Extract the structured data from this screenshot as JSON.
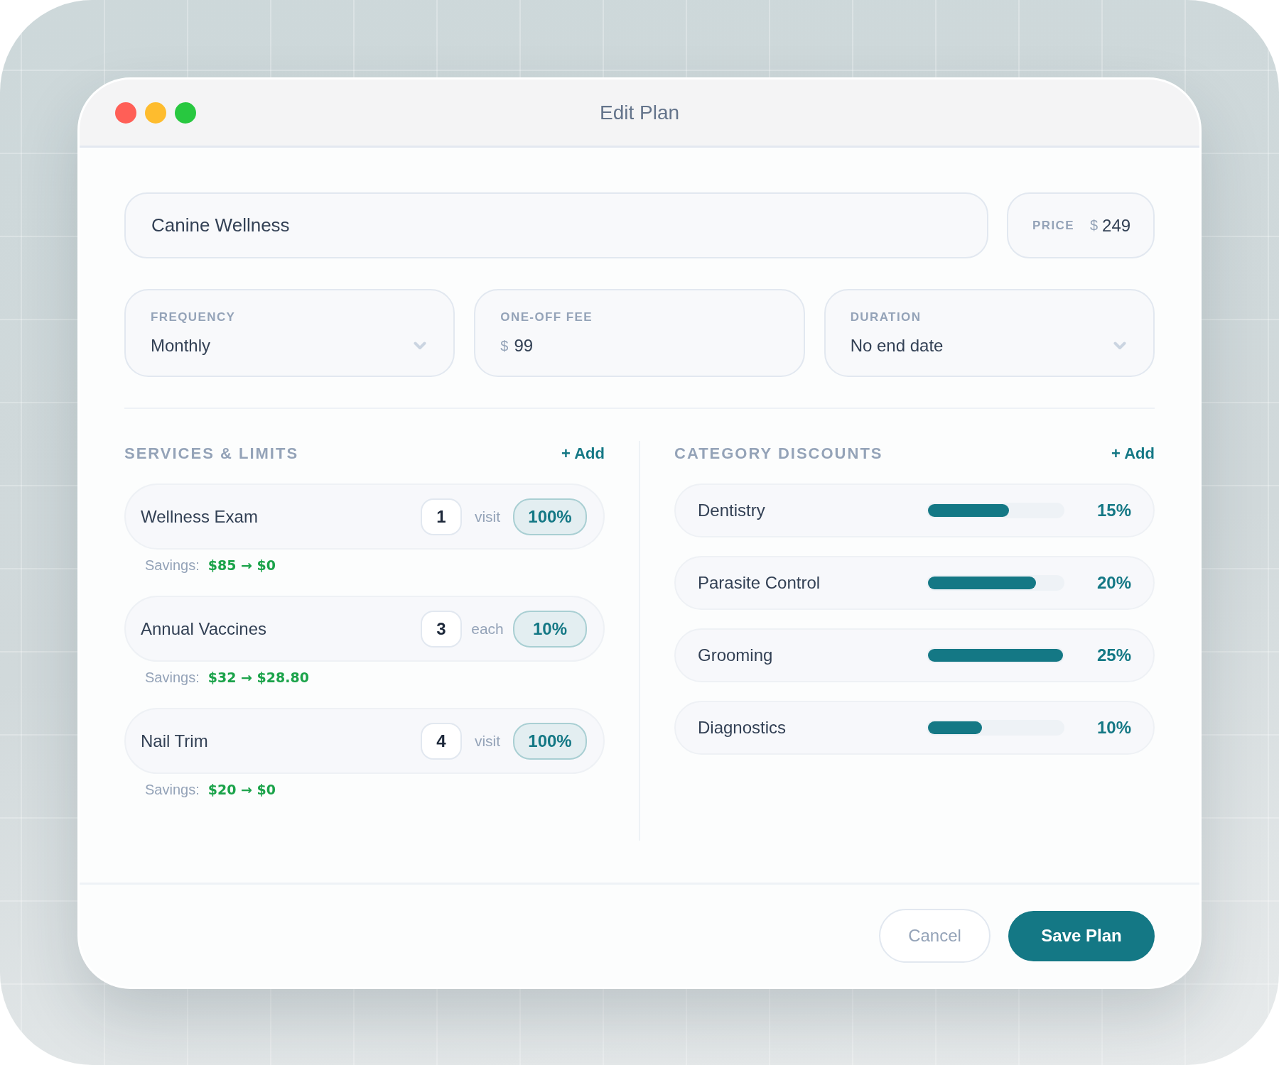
{
  "window": {
    "title": "Edit Plan"
  },
  "plan_name": {
    "value": "Canine Wellness"
  },
  "price": {
    "label": "PRICE",
    "currency": "$",
    "value": "249"
  },
  "fields": [
    {
      "kind": "select",
      "label": "FREQUENCY",
      "value": "Monthly"
    },
    {
      "kind": "money",
      "label": "ONE-OFF FEE",
      "currency": "$",
      "value": "99"
    },
    {
      "kind": "select",
      "label": "DURATION",
      "value": "No end date"
    }
  ],
  "services": {
    "title": "SERVICES & LIMITS",
    "add_label": "+ Add",
    "items": [
      {
        "name": "Wellness Exam",
        "quantity": "1",
        "unit": "visit",
        "discount": "100%",
        "savings_label": "Savings:",
        "savings": "$85 → $0"
      },
      {
        "name": "Annual Vaccines",
        "quantity": "3",
        "unit": "each",
        "discount": "10%",
        "savings_label": "Savings:",
        "savings": "$32 → $28.80"
      },
      {
        "name": "Nail Trim",
        "quantity": "4",
        "unit": "visit",
        "discount": "100%",
        "savings_label": "Savings:",
        "savings": "$20 → $0"
      }
    ]
  },
  "category_discounts": {
    "title": "CATEGORY DISCOUNTS",
    "add_label": "+ Add",
    "items": [
      {
        "name": "Dentistry",
        "level": 0.6,
        "percent": "15%"
      },
      {
        "name": "Parasite Control",
        "level": 0.8,
        "percent": "20%"
      },
      {
        "name": "Grooming",
        "level": 1,
        "percent": "25%"
      },
      {
        "name": "Diagnostics",
        "level": 0.4,
        "percent": "10%"
      }
    ]
  },
  "buttons": [
    {
      "kind": "secondary",
      "label": "Cancel"
    },
    {
      "kind": "primary",
      "label": "Save Plan"
    }
  ]
}
